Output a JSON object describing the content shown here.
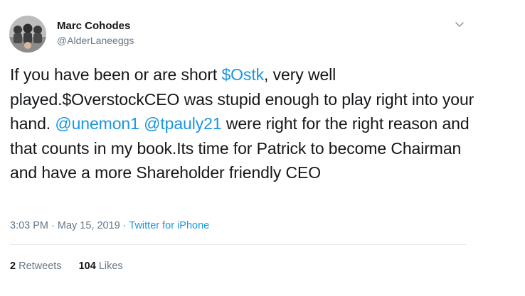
{
  "author": {
    "display_name": "Marc Cohodes",
    "handle": "@AlderLaneeggs",
    "avatar_icon": "profile-photo",
    "menu_icon": "chevron-down-icon"
  },
  "tweet": {
    "segments": [
      {
        "text": "If you have been or are short ",
        "link": false
      },
      {
        "text": "$Ostk",
        "link": true
      },
      {
        "text": ", very well played.$OverstockCEO was stupid enough to play right into your hand. ",
        "link": false
      },
      {
        "text": "@unemon1",
        "link": true
      },
      {
        "text": " ",
        "link": false
      },
      {
        "text": "@tpauly21",
        "link": true
      },
      {
        "text": " were right for the right reason and that counts in my book.Its time for Patrick to become Chairman and have a more Shareholder friendly CEO",
        "link": false
      }
    ]
  },
  "meta": {
    "time": "3:03 PM",
    "separator": " · ",
    "date": "May 15, 2019",
    "source": "Twitter for iPhone"
  },
  "stats": {
    "retweets_count": "2",
    "retweets_label": "Retweets",
    "likes_count": "104",
    "likes_label": "Likes"
  },
  "colors": {
    "link": "#1b95e0",
    "secondary_text": "#657786",
    "primary_text": "#14171a",
    "divider": "#e6ecf0"
  }
}
